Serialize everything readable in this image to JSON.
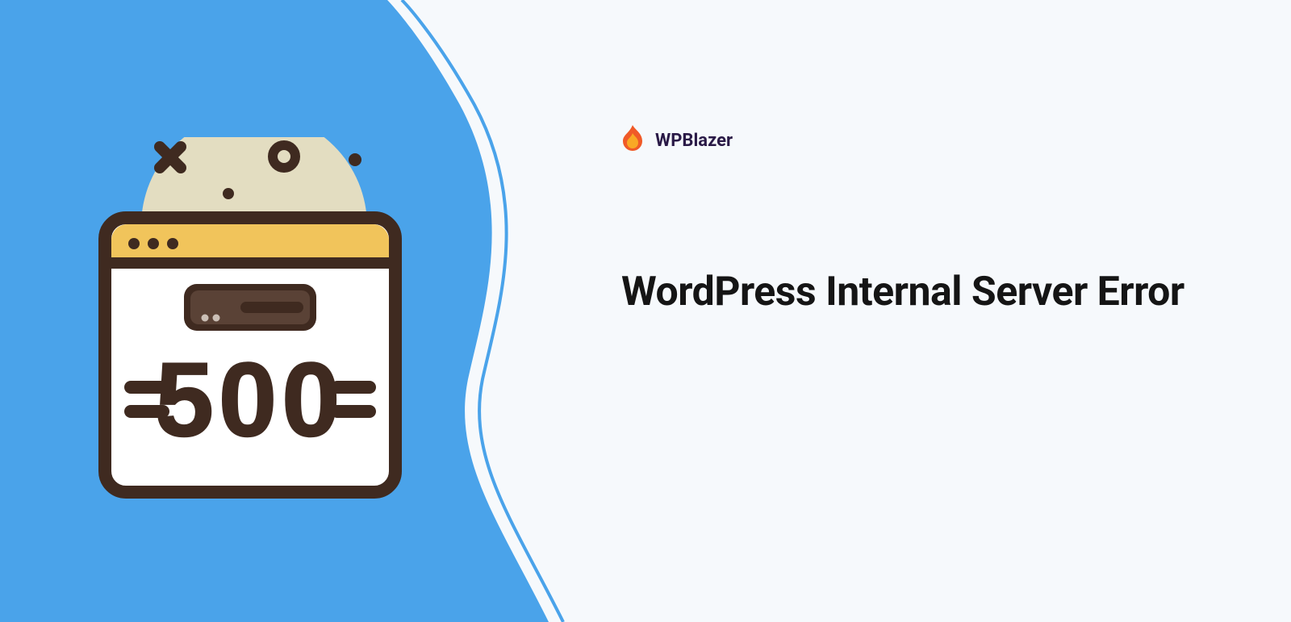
{
  "brand": {
    "name": "WPBlazer"
  },
  "heading": "WordPress Internal Server Error",
  "error_code": "500",
  "colors": {
    "blue": "#4aa3ea",
    "offwhite": "#f6f9fc",
    "brown": "#3f2a20",
    "yellow": "#f1c45b",
    "cream": "#e3ddc1",
    "flame_outer": "#f05a28",
    "flame_inner": "#f9a825",
    "brand_text": "#2a1a47"
  }
}
